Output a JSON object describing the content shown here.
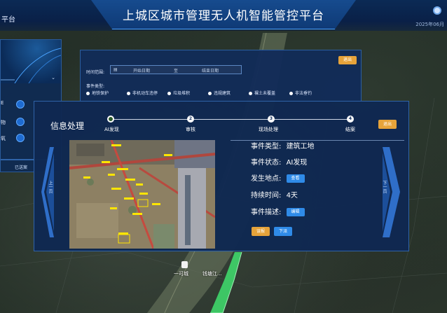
{
  "header": {
    "title": "上城区城市管理无人机智能管控平台",
    "left_fragment": "平台",
    "date_fragment": "2025年06月"
  },
  "left_panel": {
    "tags": [
      "E",
      "物",
      "氧"
    ],
    "button_label": "已送案"
  },
  "search_panel": {
    "time_label": "时间范围:",
    "start_placeholder": "开始日期",
    "separator": "至",
    "end_placeholder": "结束日期",
    "exit_label": "退出",
    "type_label": "事件类型:",
    "types": [
      "地铁保护",
      "非机动车违停",
      "垃圾堆积",
      "违规建筑",
      "裸土未覆盖",
      "非法垂钓"
    ]
  },
  "dialog": {
    "title": "信息处理",
    "exit_label": "退出",
    "steps": [
      {
        "num": "",
        "label": "AI发现"
      },
      {
        "num": "2",
        "label": "审核"
      },
      {
        "num": "3",
        "label": "现场处理"
      },
      {
        "num": "4",
        "label": "结案"
      }
    ],
    "prev_label": "上一页",
    "next_label": "下一页",
    "fields": {
      "type_label": "事件类型:",
      "type_value": "建筑工地",
      "status_label": "事件状态:",
      "status_value": "AI发现",
      "location_label": "发生地点:",
      "location_button": "查看",
      "duration_label": "持续时间:",
      "duration_value": "4天",
      "desc_label": "事件描述:",
      "desc_button": "编辑"
    },
    "actions": {
      "left": "误报",
      "right": "下派"
    }
  },
  "map_labels": [
    "一可城",
    "钱塘江..."
  ],
  "colors": {
    "header_bg": "#0b2a55",
    "panel_bg": "#102852",
    "accent_orange": "#e6a33a",
    "accent_blue": "#2f8be8",
    "river_green": "#3fd66a"
  }
}
